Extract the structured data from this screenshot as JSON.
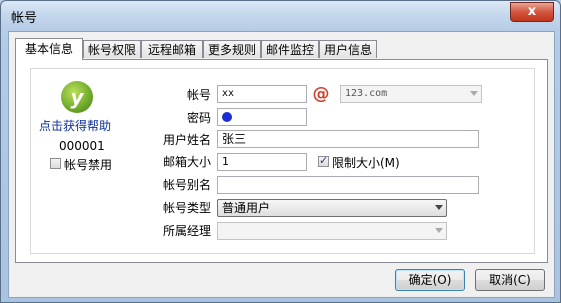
{
  "window": {
    "title": "帐号",
    "close_label": "x"
  },
  "tabs": [
    {
      "label": "基本信息",
      "active": true
    },
    {
      "label": "帐号权限"
    },
    {
      "label": "远程邮箱"
    },
    {
      "label": "更多规则"
    },
    {
      "label": "邮件监控"
    },
    {
      "label": "用户信息"
    }
  ],
  "left": {
    "logo_letter": "y",
    "help_link": "点击获得帮助",
    "code": "000001",
    "disable_label": "帐号禁用",
    "disabled": false
  },
  "form": {
    "account_label": "帐号",
    "account_value": "xx",
    "at_symbol": "@",
    "domain_value": "123.com",
    "password_label": "密码",
    "username_label": "用户姓名",
    "username_value": "张三",
    "mailbox_size_label": "邮箱大小",
    "mailbox_size_value": "1",
    "limit_size_label": "限制大小(M)",
    "limit_size_checked": true,
    "alias_label": "帐号别名",
    "alias_value": "",
    "type_label": "帐号类型",
    "type_value": "普通用户",
    "manager_label": "所属经理",
    "manager_value": ""
  },
  "buttons": {
    "ok": "确定(O)",
    "cancel": "取消(C)"
  }
}
